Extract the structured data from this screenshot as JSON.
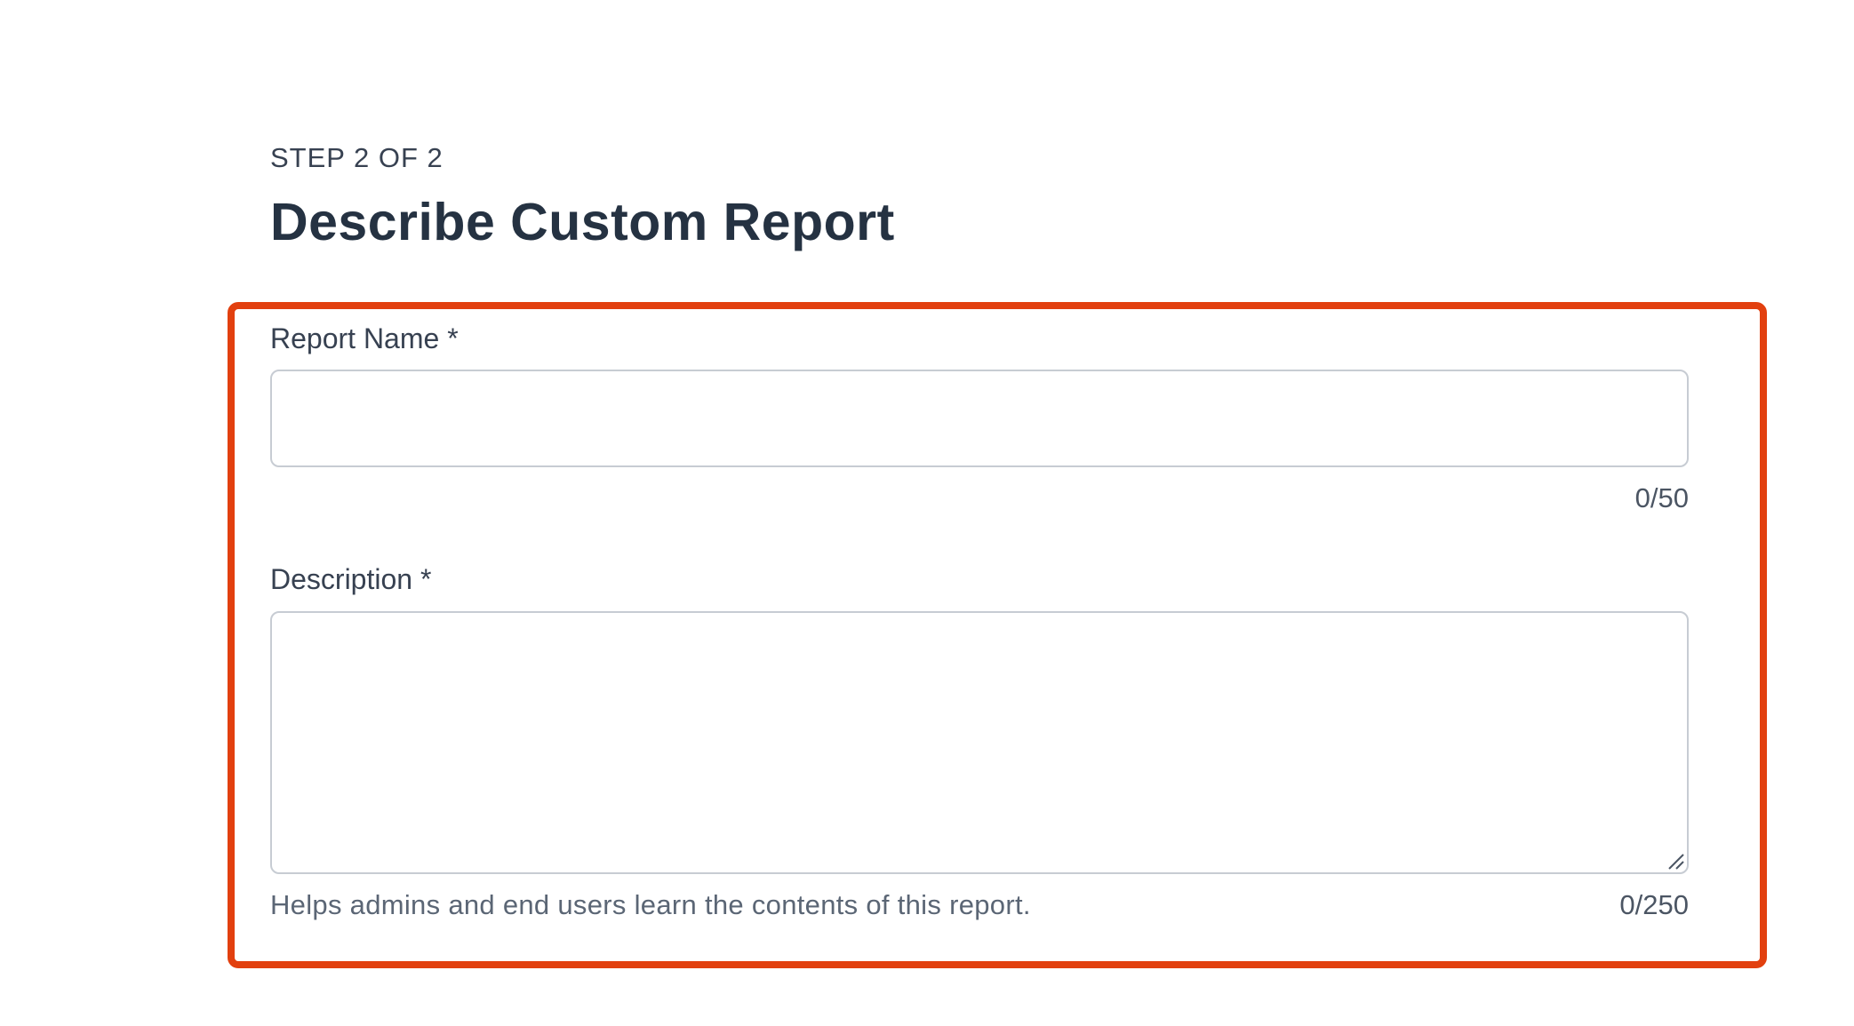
{
  "header": {
    "step_label": "STEP 2 OF 2",
    "title": "Describe Custom Report"
  },
  "form": {
    "report_name": {
      "label": "Report Name *",
      "value": "",
      "placeholder": "",
      "counter": "0/50"
    },
    "description": {
      "label": "Description *",
      "value": "",
      "placeholder": "",
      "helper": "Helps admins and end users learn the contents of this report.",
      "counter": "0/250"
    }
  },
  "colors": {
    "highlight": "#e2400f",
    "title": "#253242",
    "input_border": "#c7ccd3"
  },
  "icons": {
    "resize_handle": "resize-handle-icon"
  }
}
